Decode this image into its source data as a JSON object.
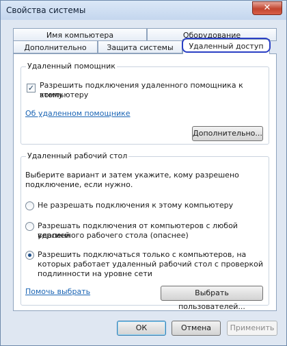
{
  "window": {
    "title": "Свойства системы",
    "close_symbol": "✕"
  },
  "tabs": {
    "row1": [
      "Имя компьютера",
      "Оборудование"
    ],
    "row2": [
      "Дополнительно",
      "Защита системы",
      "Удаленный доступ"
    ],
    "active": "Удаленный доступ"
  },
  "assistance": {
    "group_title": "Удаленный помощник",
    "allow_checkbox": {
      "checked": true,
      "label_line1": "Разрешить подключения удаленного помощника к этому",
      "label_line2": "компьютеру"
    },
    "about_link": "Об удаленном помощнике",
    "advanced_button": "Дополнительно..."
  },
  "desktop": {
    "group_title": "Удаленный рабочий стол",
    "instructions_line1": "Выберите вариант и затем укажите, кому разрешено",
    "instructions_line2": "подключение, если нужно.",
    "option1": "Не разрешать подключения к этому компьютеру",
    "option2_line1": "Разрешать подключения от компьютеров с любой версией",
    "option2_line2": "удаленного рабочего стола (опаснее)",
    "option3_line1": "Разрешить подключаться только с компьютеров, на",
    "option3_line2": "которых работает удаленный рабочий стол с проверкой",
    "option3_line3": "подлинности на уровне сети",
    "selected_option": 3,
    "help_link": "Помочь выбрать",
    "select_users_button": "Выбрать пользователей..."
  },
  "footer": {
    "ok": "ОК",
    "cancel": "Отмена",
    "apply": "Применить"
  }
}
